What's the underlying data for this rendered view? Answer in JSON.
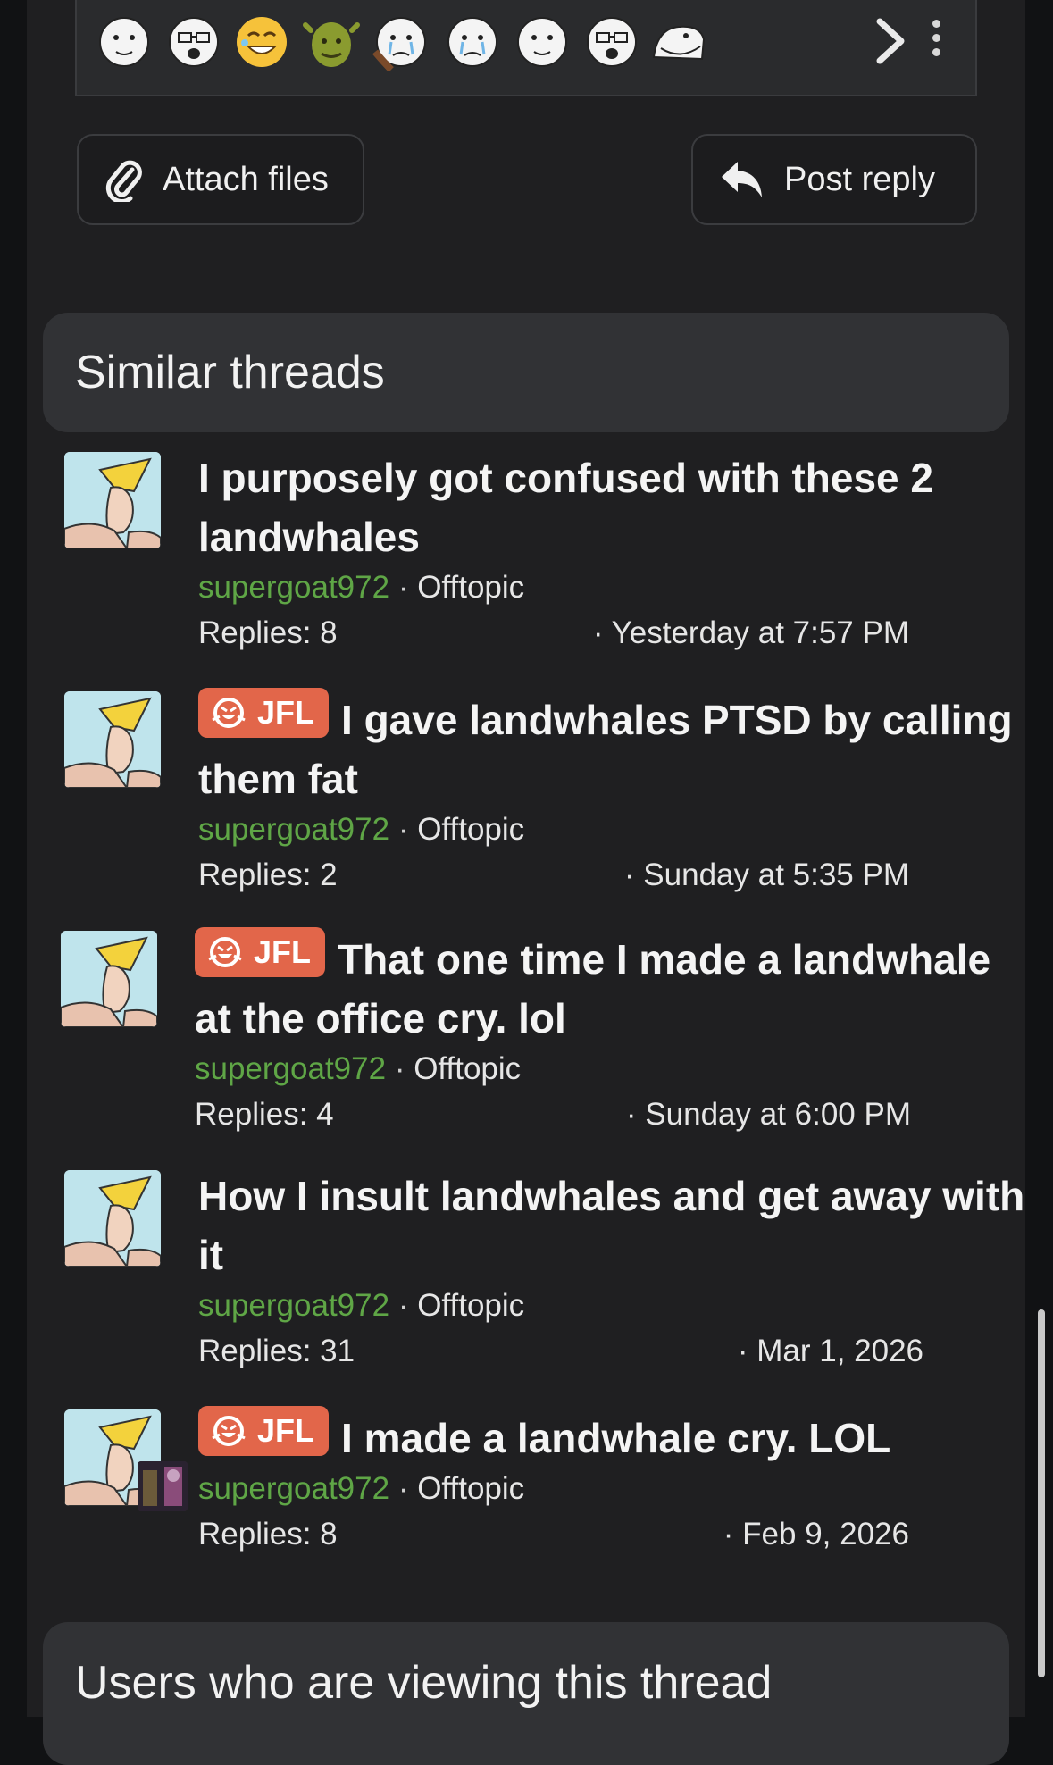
{
  "emoji_bar": {
    "emojis": [
      {
        "icon": "wojak-smug-icon"
      },
      {
        "icon": "wojak-glasses-icon"
      },
      {
        "icon": "cringe-smile-icon"
      },
      {
        "icon": "shrek-icon"
      },
      {
        "icon": "wojak-crying-icon"
      },
      {
        "icon": "wojak-tears-icon"
      },
      {
        "icon": "wojak-grin-icon"
      },
      {
        "icon": "wojak-nerd-icon"
      },
      {
        "icon": "troll-face-icon"
      }
    ],
    "next_icon": "chevron-right-icon",
    "more_icon": "vertical-ellipsis-icon"
  },
  "actions": {
    "attach_label": "Attach files",
    "reply_label": "Post reply"
  },
  "similar_threads": {
    "heading": "Similar threads",
    "items": [
      {
        "prefix": "",
        "title": "I purposely got confused with these 2 landwhales",
        "author": "supergoat972",
        "forum": "Offtopic",
        "replies": "Replies: 8",
        "date": "· Yesterday at 7:57 PM"
      },
      {
        "prefix": "JFL",
        "title": "I gave landwhales PTSD by calling them fat",
        "author": "supergoat972",
        "forum": "Offtopic",
        "replies": "Replies: 2",
        "date": "· Sunday at 5:35 PM"
      },
      {
        "prefix": "JFL",
        "title": "That one time I made a landwhale at the office cry. lol",
        "author": "supergoat972",
        "forum": "Offtopic",
        "replies": "Replies: 4",
        "date": "· Sunday at 6:00 PM"
      },
      {
        "prefix": "",
        "title": "How I insult landwhales and get away with it",
        "author": "supergoat972",
        "forum": "Offtopic",
        "replies": "Replies: 31",
        "date": "· Mar 1, 2026"
      },
      {
        "prefix": "JFL",
        "title": "I made a landwhale cry. LOL",
        "author": "supergoat972",
        "forum": "Offtopic",
        "replies": "Replies: 8",
        "date": "· Feb 9, 2026"
      }
    ],
    "separator": "·"
  },
  "viewers": {
    "heading": "Users who are viewing this thread"
  },
  "colors": {
    "background": "#1f1f21",
    "header_bg": "#313235",
    "author": "#5fa646",
    "prefix_bg": "#e2664a"
  }
}
